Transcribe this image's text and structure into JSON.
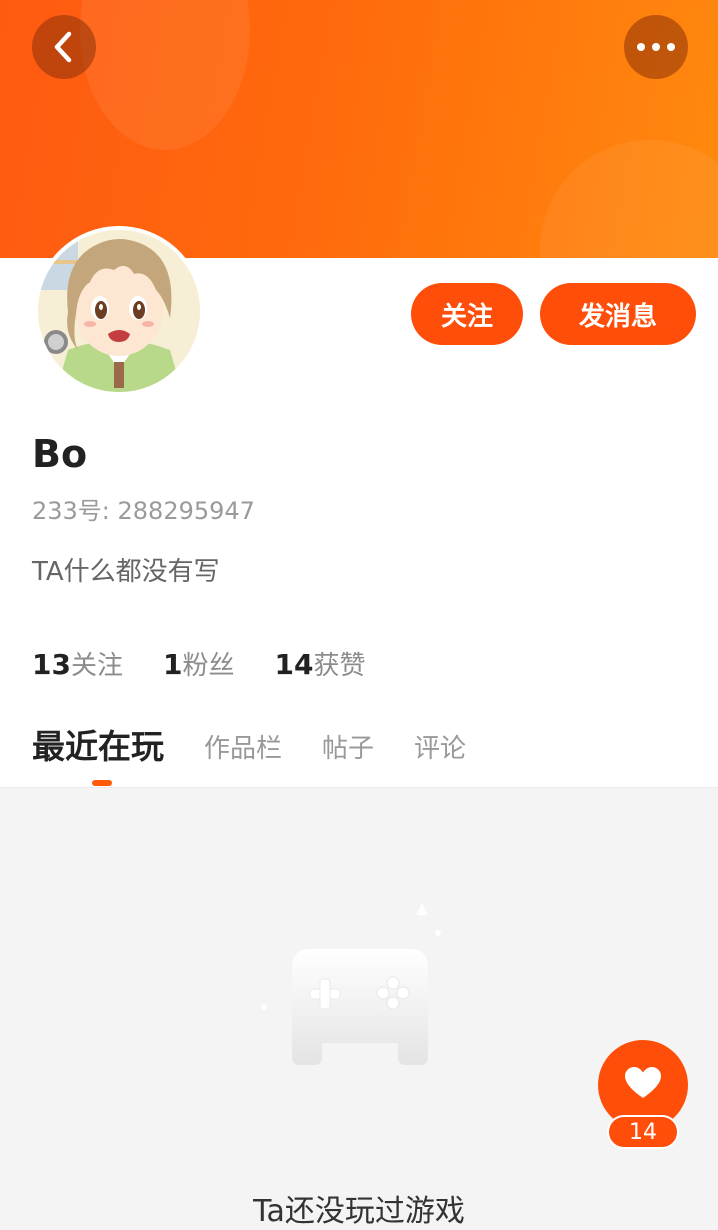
{
  "profile": {
    "username": "Bo",
    "id_text": "233号: 288295947",
    "bio": "TA什么都没有写"
  },
  "actions": {
    "follow_label": "关注",
    "message_label": "发消息"
  },
  "stats": [
    {
      "num": "13",
      "label": "关注"
    },
    {
      "num": "1",
      "label": "粉丝"
    },
    {
      "num": "14",
      "label": "获赞"
    }
  ],
  "tabs": [
    {
      "label": "最近在玩",
      "active": true
    },
    {
      "label": "作品栏",
      "active": false
    },
    {
      "label": "帖子",
      "active": false
    },
    {
      "label": "评论",
      "active": false
    }
  ],
  "empty_state": {
    "message": "Ta还没玩过游戏"
  },
  "like_fab": {
    "count": "14"
  },
  "colors": {
    "accent": "#ff4e0a",
    "header_start": "#ff5a12",
    "header_end": "#ff8a0e"
  },
  "icons": {
    "back": "chevron-left-icon",
    "more": "more-horizontal-icon",
    "like": "heart-icon",
    "empty": "gamepad-icon"
  }
}
